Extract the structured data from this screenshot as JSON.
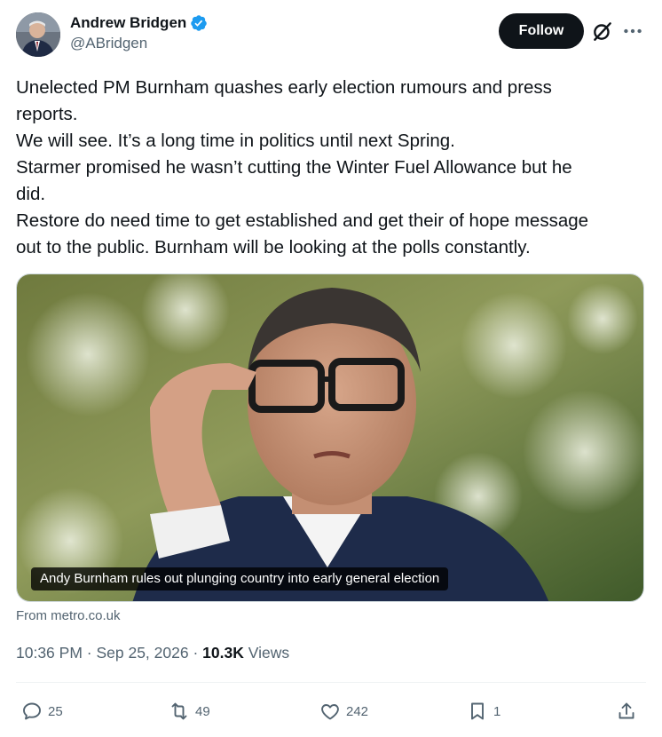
{
  "author": {
    "display_name": "Andrew Bridgen",
    "handle": "@ABridgen",
    "verified_icon": "verified-badge-icon",
    "verified_color": "#1d9bf0"
  },
  "header": {
    "follow_label": "Follow",
    "grok_icon": "grok-icon",
    "more_icon": "more-icon"
  },
  "tweet": {
    "lines": [
      "Unelected PM Burnham quashes early election rumours and press",
      "reports.",
      "We will see. It’s a long time in politics until next Spring.",
      "Starmer promised he wasn’t cutting the Winter Fuel Allowance but he",
      "did.",
      "Restore do need time to get established and get their of hope message",
      "out to the public. Burnham will be looking at the polls constantly."
    ]
  },
  "media": {
    "caption": "Andy Burnham rules out plunging country into early general election",
    "source": "From metro.co.uk"
  },
  "meta": {
    "time": "10:36 PM",
    "separator": " · ",
    "date": "Sep 25, 2026",
    "separator2": " · ",
    "views_count": "10.3K",
    "views_label": " Views"
  },
  "actions": {
    "replies": "25",
    "reposts": "49",
    "likes": "242",
    "bookmarks": "1"
  },
  "colors": {
    "text": "#0f1419",
    "secondary": "#536471",
    "follow_bg": "#0f1419",
    "divider": "#eff3f4"
  }
}
